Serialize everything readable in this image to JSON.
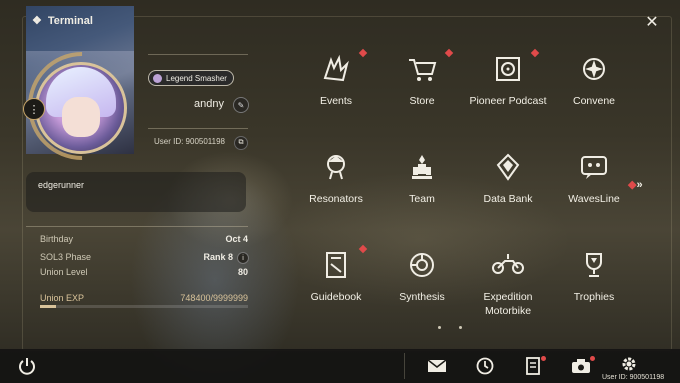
{
  "window": {
    "title": "Terminal"
  },
  "profile": {
    "title_badge": "Legend Smasher",
    "name": "andny",
    "user_id": "User ID: 900501198",
    "signature": "edgerunner",
    "stats": [
      {
        "label": "Birthday",
        "value": "Oct 4"
      },
      {
        "label": "SOL3 Phase",
        "value": "Rank 8"
      },
      {
        "label": "Union Level",
        "value": "80"
      },
      {
        "label": "Union EXP",
        "value": "748400/9999999"
      }
    ],
    "union_exp_fraction": 0.0748
  },
  "menu": [
    {
      "label": "Events",
      "icon": "events-icon",
      "badge": true
    },
    {
      "label": "Store",
      "icon": "cart-icon",
      "badge": true
    },
    {
      "label": "Pioneer Podcast",
      "icon": "podcast-icon",
      "badge": true
    },
    {
      "label": "Convene",
      "icon": "convene-icon",
      "badge": false
    },
    {
      "label": "Resonators",
      "icon": "resonator-icon",
      "badge": false
    },
    {
      "label": "Team",
      "icon": "team-icon",
      "badge": false
    },
    {
      "label": "Data Bank",
      "icon": "databank-icon",
      "badge": false
    },
    {
      "label": "WavesLine",
      "icon": "chat-icon",
      "badge": false
    },
    {
      "label": "Guidebook",
      "icon": "guidebook-icon",
      "badge": true
    },
    {
      "label": "Synthesis",
      "icon": "synthesis-icon",
      "badge": false
    },
    {
      "label": "Expedition Motorbike",
      "icon": "motorbike-icon",
      "badge": false
    },
    {
      "label": "Trophies",
      "icon": "trophy-icon",
      "badge": false
    }
  ],
  "footer": {
    "user_id": "User ID: 900501198"
  },
  "colors": {
    "accent": "#d9c39a",
    "alert": "#e04a4a",
    "panel": "#2f2c22"
  }
}
